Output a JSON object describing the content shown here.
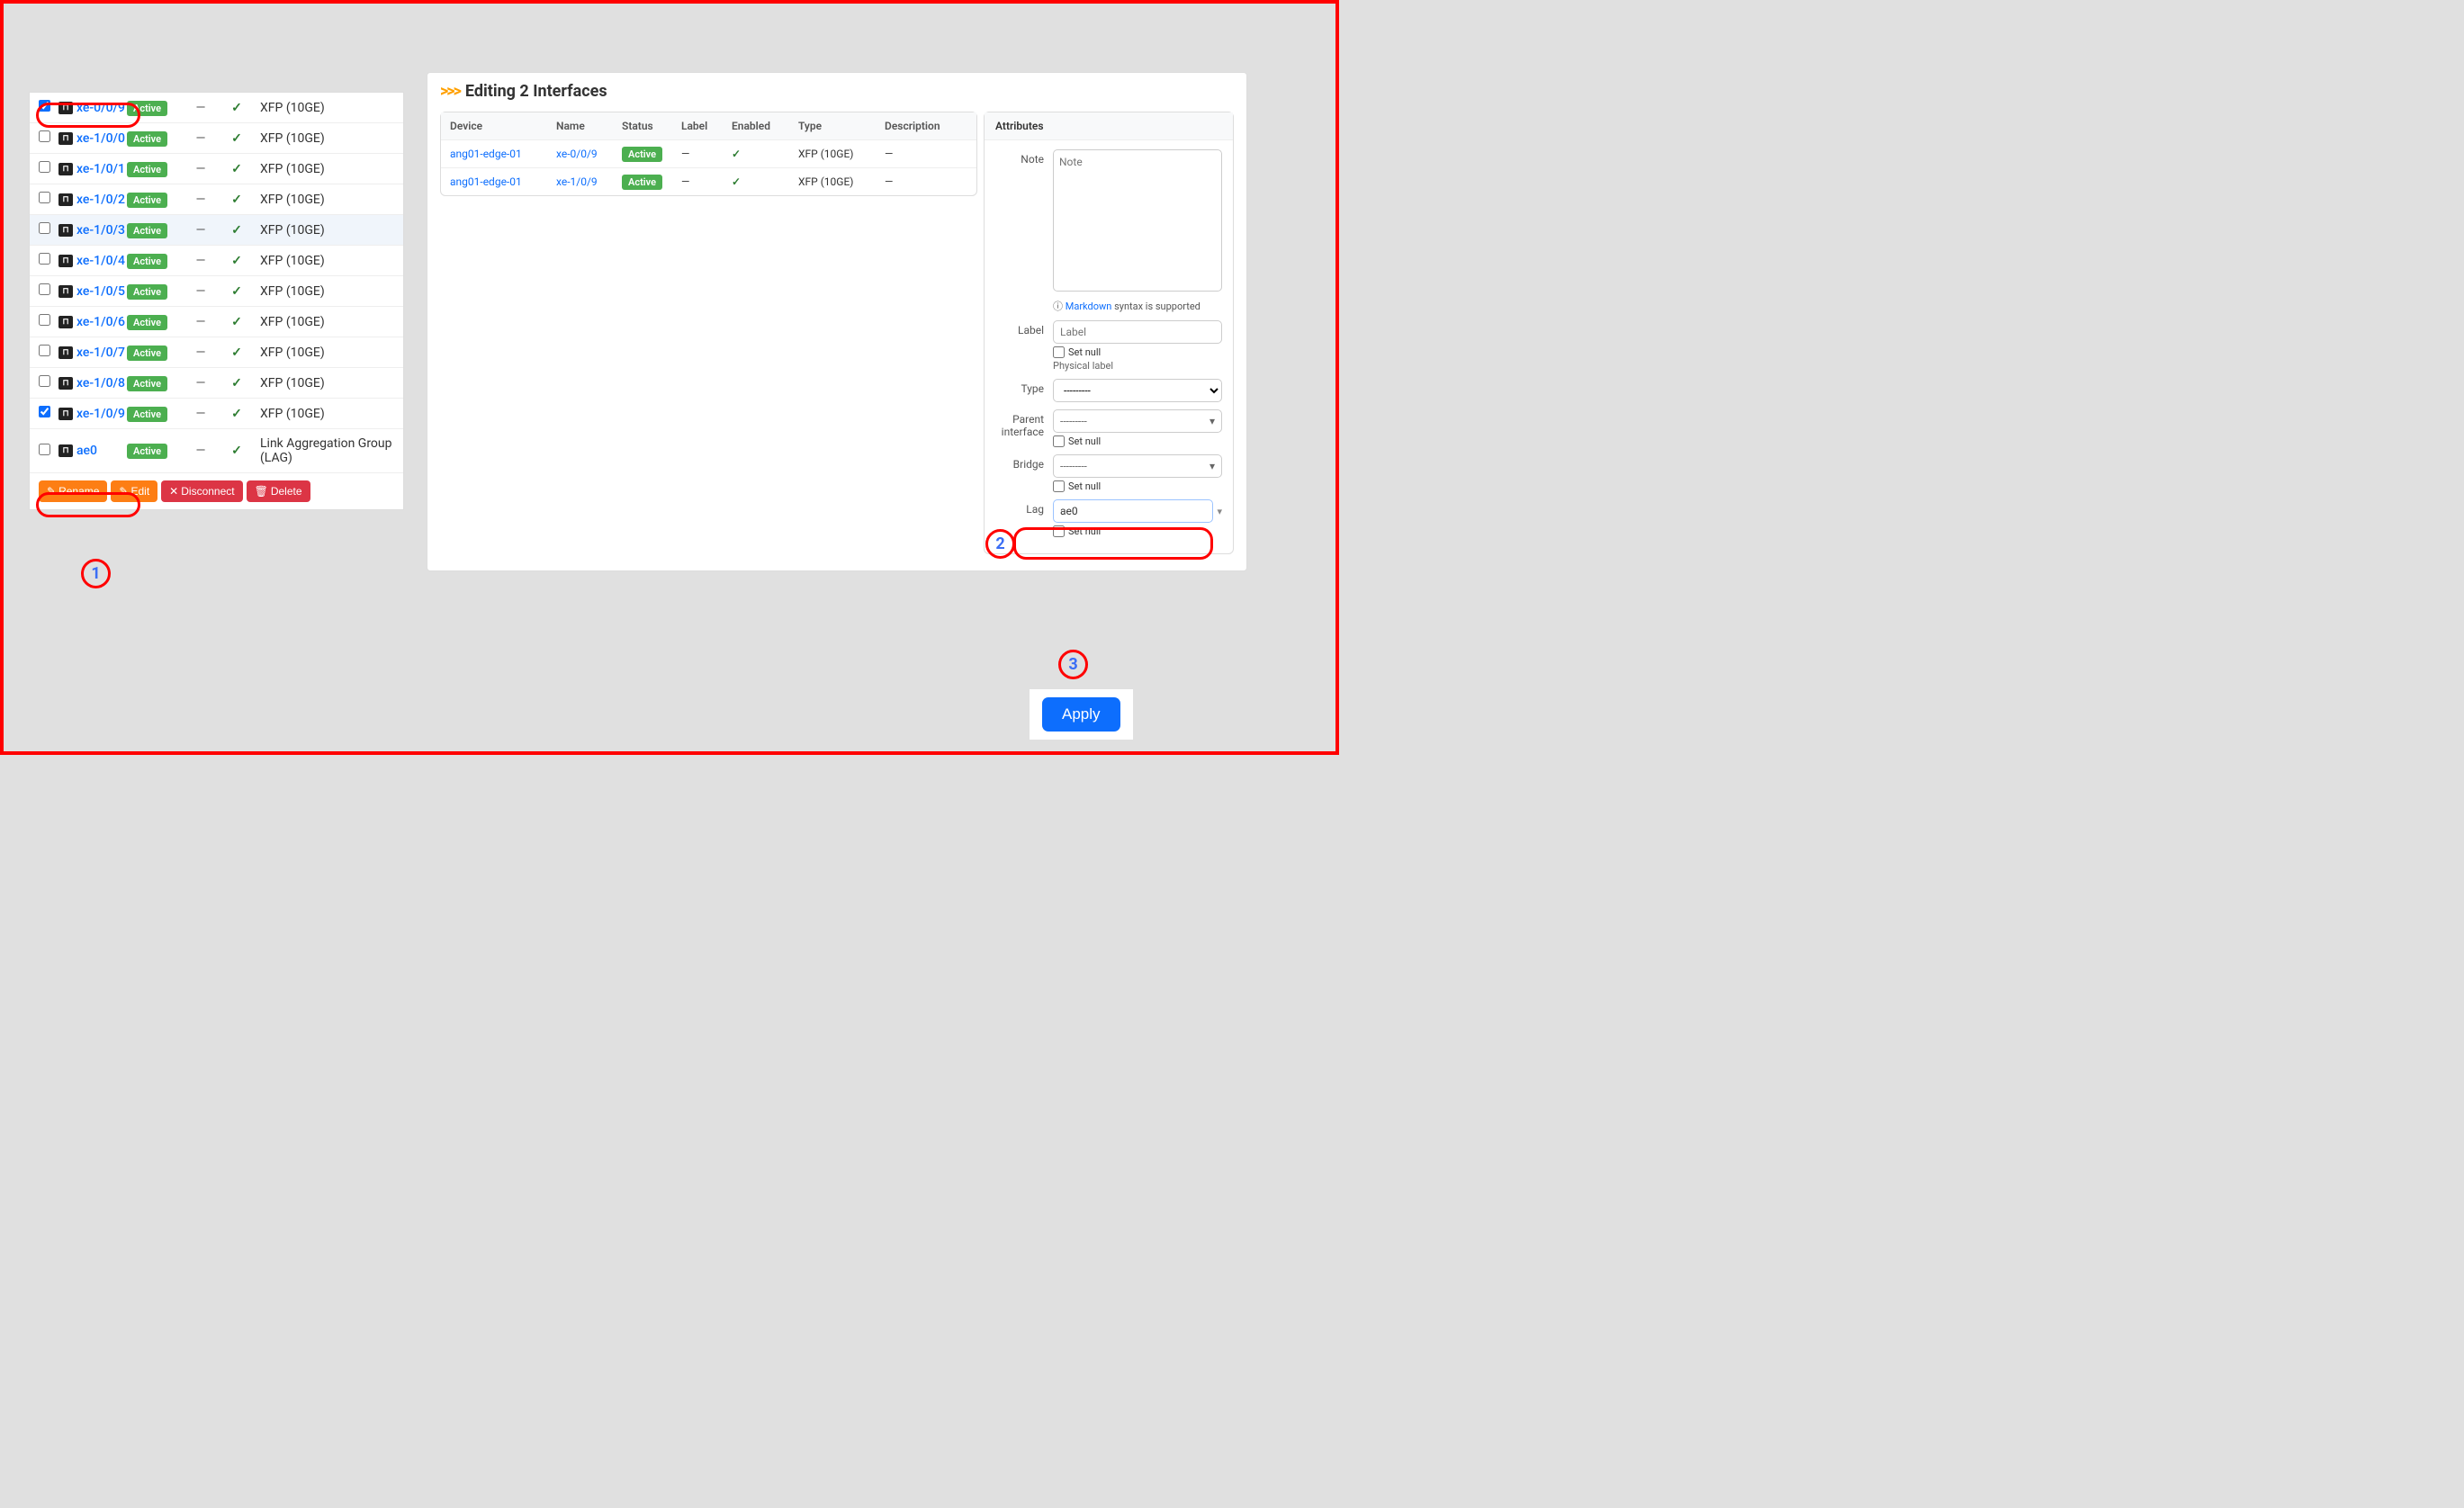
{
  "editing_title": "Editing 2 Interfaces",
  "left_table": {
    "status_badge": "Active",
    "rows": [
      {
        "checked": true,
        "name": "xe-0/0/9",
        "col2": "—",
        "type": "XFP (10GE)"
      },
      {
        "checked": false,
        "name": "xe-1/0/0",
        "col2": "—",
        "type": "XFP (10GE)"
      },
      {
        "checked": false,
        "name": "xe-1/0/1",
        "col2": "—",
        "type": "XFP (10GE)"
      },
      {
        "checked": false,
        "name": "xe-1/0/2",
        "col2": "—",
        "type": "XFP (10GE)"
      },
      {
        "checked": false,
        "name": "xe-1/0/3",
        "col2": "—",
        "type": "XFP (10GE)",
        "highlight": true
      },
      {
        "checked": false,
        "name": "xe-1/0/4",
        "col2": "—",
        "type": "XFP (10GE)"
      },
      {
        "checked": false,
        "name": "xe-1/0/5",
        "col2": "—",
        "type": "XFP (10GE)"
      },
      {
        "checked": false,
        "name": "xe-1/0/6",
        "col2": "—",
        "type": "XFP (10GE)"
      },
      {
        "checked": false,
        "name": "xe-1/0/7",
        "col2": "—",
        "type": "XFP (10GE)"
      },
      {
        "checked": false,
        "name": "xe-1/0/8",
        "col2": "—",
        "type": "XFP (10GE)"
      },
      {
        "checked": true,
        "name": "xe-1/0/9",
        "col2": "—",
        "type": "XFP (10GE)"
      },
      {
        "checked": false,
        "name": "ae0",
        "col2": "—",
        "type": "Link Aggregation Group (LAG)"
      }
    ]
  },
  "actions": {
    "rename": "Rename",
    "edit": "Edit",
    "disconnect": "Disconnect",
    "delete": "Delete"
  },
  "edit_table": {
    "headers": {
      "device": "Device",
      "name": "Name",
      "status": "Status",
      "label": "Label",
      "enabled": "Enabled",
      "type": "Type",
      "description": "Description"
    },
    "rows": [
      {
        "device": "ang01-edge-01",
        "name": "xe-0/0/9",
        "status": "Active",
        "label": "—",
        "type": "XFP (10GE)",
        "description": "—"
      },
      {
        "device": "ang01-edge-01",
        "name": "xe-1/0/9",
        "status": "Active",
        "label": "—",
        "type": "XFP (10GE)",
        "description": "—"
      }
    ]
  },
  "attributes": {
    "title": "Attributes",
    "note_label": "Note",
    "note_placeholder": "Note",
    "markdown_link": "Markdown",
    "markdown_text": " syntax is supported",
    "label_label": "Label",
    "label_placeholder": "Label",
    "set_null": "Set null",
    "physical_label": "Physical label",
    "type_label": "Type",
    "type_value": "---------",
    "parent_label": "Parent interface",
    "parent_value": "---------",
    "bridge_label": "Bridge",
    "bridge_value": "---------",
    "lag_label": "Lag",
    "lag_value": "ae0"
  },
  "apply_label": "Apply",
  "annotations": {
    "one": "1",
    "two": "2",
    "three": "3"
  }
}
